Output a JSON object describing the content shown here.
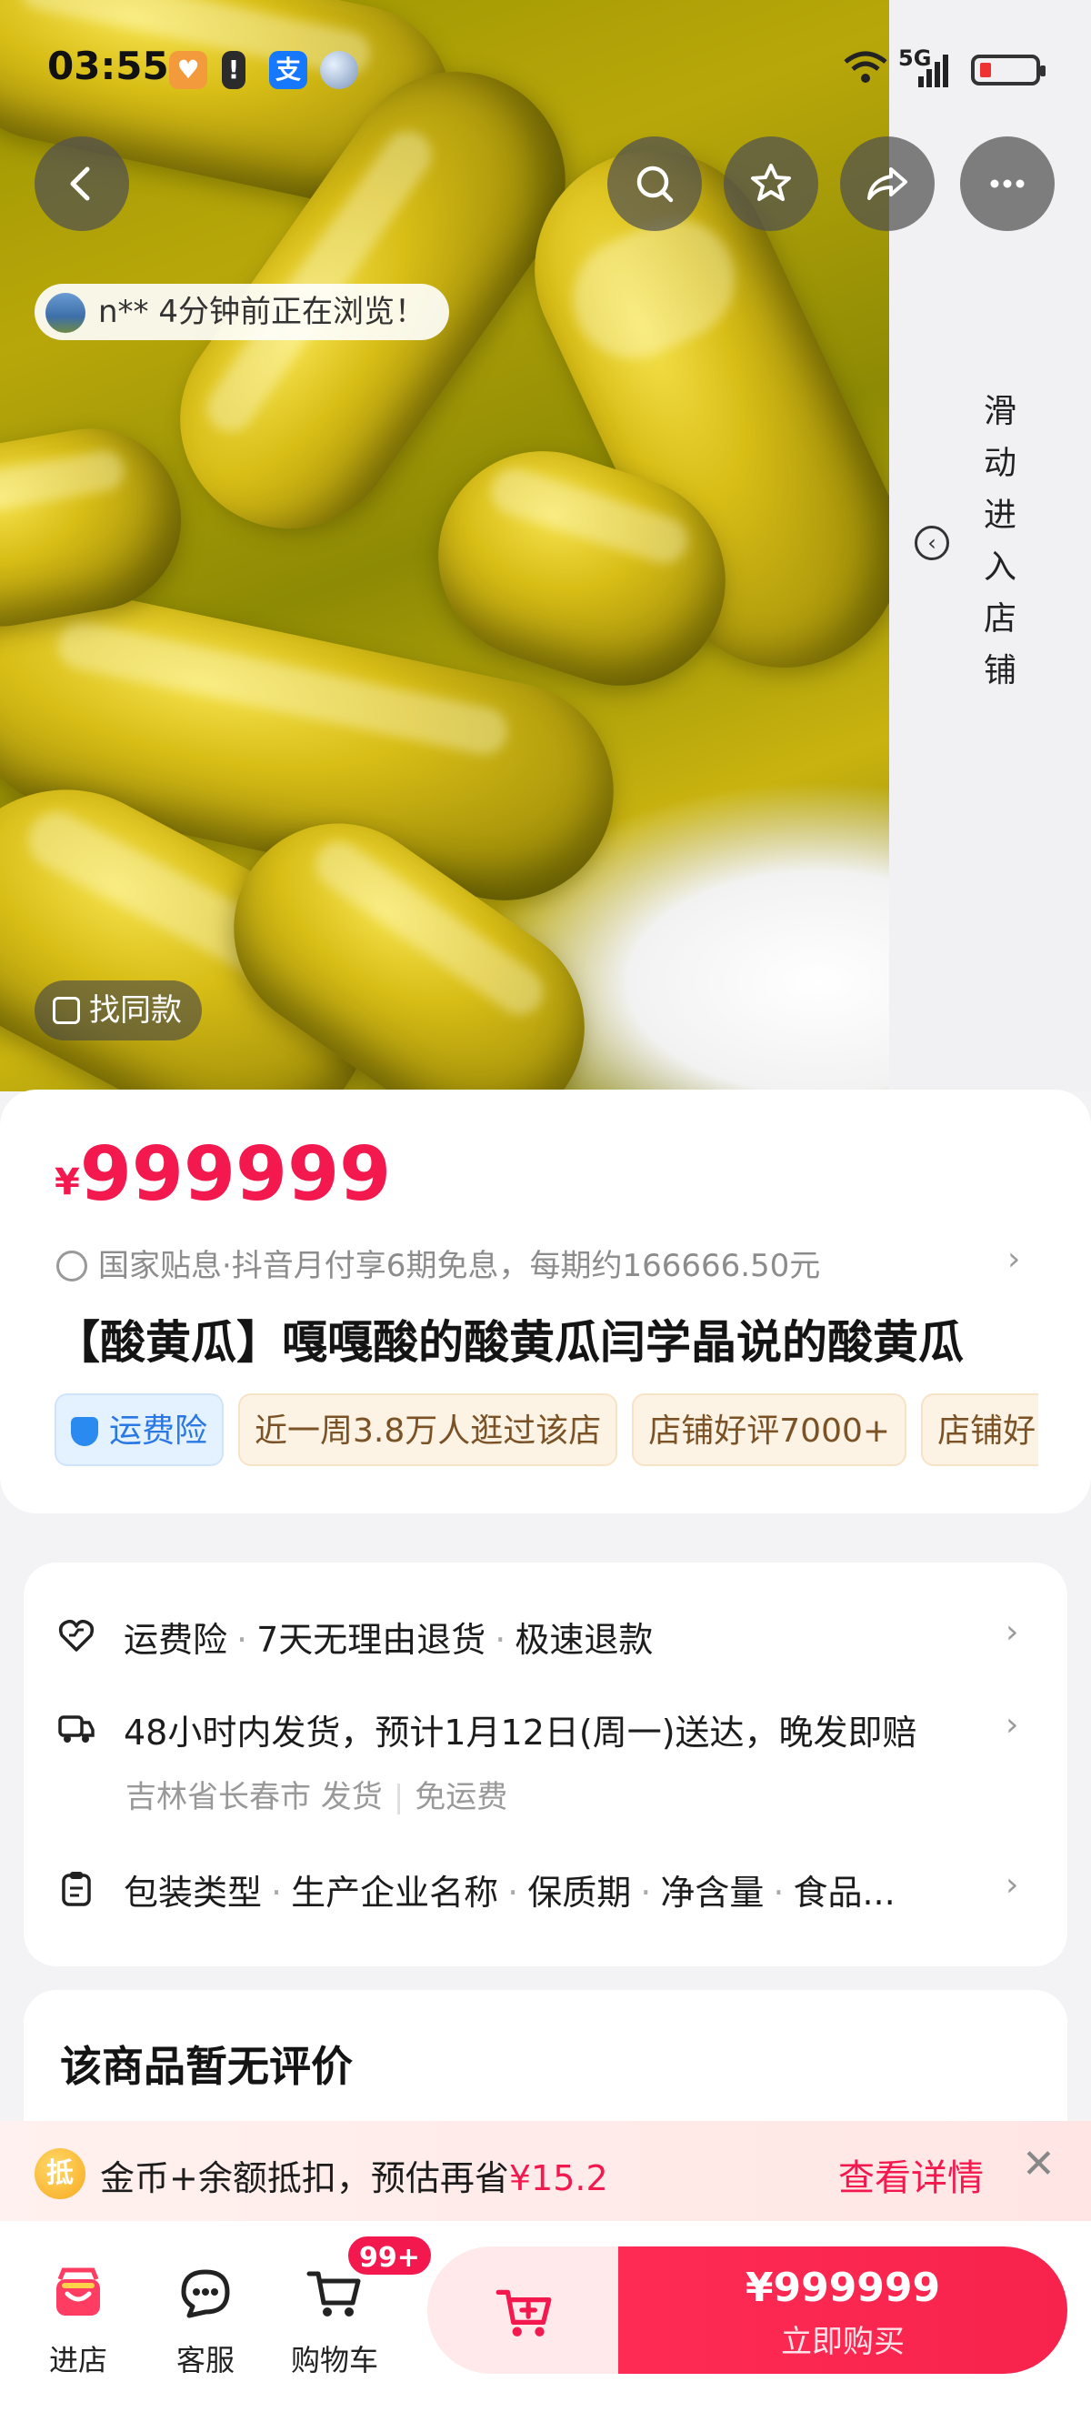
{
  "status_bar": {
    "time": "03:55",
    "network": "5G",
    "apps": [
      "shopping-bag-icon",
      "alert-icon",
      "alipay-icon",
      "orb-icon"
    ]
  },
  "hero": {
    "viewer_text": "n** 4分钟前正在浏览！",
    "find_same_label": "找同款",
    "side_panel_text": [
      "滑",
      "动",
      "进",
      "入",
      "店",
      "铺"
    ]
  },
  "product": {
    "currency": "¥",
    "price": "999999",
    "subsidy_text": "国家贴息·抖音月付享6期免息，每期约166666.50元",
    "title": "【酸黄瓜】嘎嘎酸的酸黄瓜闫学晶说的酸黄瓜",
    "tags": [
      "运费险",
      "近一周3.8万人逛过该店",
      "店铺好评7000+",
      "店铺好"
    ]
  },
  "services": {
    "guarantee": [
      "运费险",
      "7天无理由退货",
      "极速退款"
    ],
    "shipping": "48小时内发货，预计1月12日(周一)送达，晚发即赔",
    "shipping_from": "吉林省长春市 发货",
    "shipping_fee": "免运费",
    "params": [
      "包装类型",
      "生产企业名称",
      "保质期",
      "净含量",
      "食品..."
    ]
  },
  "reviews": {
    "title": "该商品暂无评价"
  },
  "promo": {
    "badge": "抵",
    "text": "金币+余额抵扣，预估再省",
    "amount": "¥15.2",
    "detail_label": "查看详情"
  },
  "bottom_bar": {
    "tabs": [
      {
        "label": "进店",
        "icon": "store-icon"
      },
      {
        "label": "客服",
        "icon": "chat-icon"
      },
      {
        "label": "购物车",
        "icon": "cart-icon"
      }
    ],
    "cart_badge": "99+",
    "buy_price": "¥999999",
    "buy_label": "立即购买"
  },
  "colors": {
    "accent": "#f3184d",
    "blue": "#2a78e4"
  }
}
